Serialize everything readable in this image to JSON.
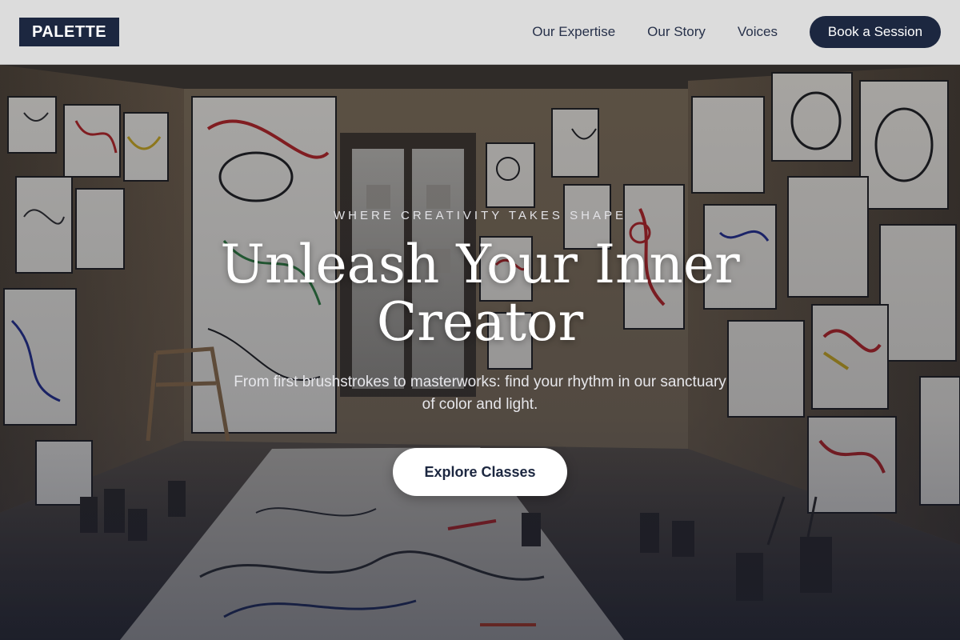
{
  "header": {
    "logo": "PALETTE",
    "nav": [
      "Our Expertise",
      "Our Story",
      "Voices"
    ],
    "cta_label": "Book a Session"
  },
  "hero": {
    "eyebrow": "WHERE CREATIVITY TAKES SHAPE",
    "headline": "Unleash Your Inner Creator",
    "subtext": "From first brushstrokes to masterworks: find your rhythm in our sanctuary of color and light.",
    "cta_label": "Explore Classes",
    "background_image": "art-studio-room-photo"
  },
  "colors": {
    "navy": "#1c2740",
    "header_bg": "#dcdcdc",
    "white": "#ffffff"
  }
}
